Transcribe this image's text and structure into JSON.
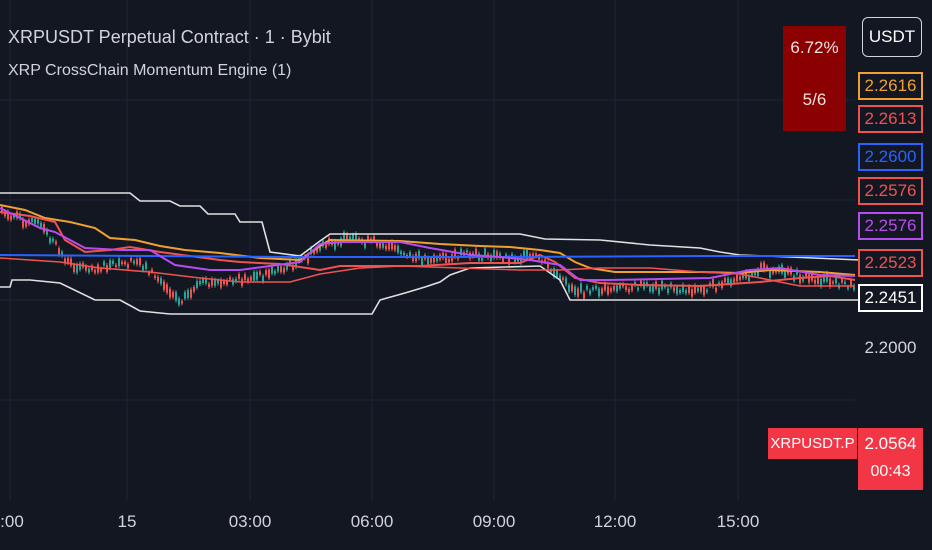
{
  "header": {
    "title": "XRPUSDT Perpetual Contract · 1 · Bybit",
    "indicator": "XRP CrossChain Momentum Engine (1)"
  },
  "info_panel": {
    "percent": "6.72%",
    "ratio": "5/6",
    "color": "#8b0000"
  },
  "currency_button": "USDT",
  "price_axis": {
    "tags": [
      {
        "value": "2.2616",
        "color": "#f0a030"
      },
      {
        "value": "2.2613",
        "color": "#ef5350"
      },
      {
        "value": "2.2600",
        "color": "#2962ff"
      },
      {
        "value": "2.2576",
        "color": "#ef5350"
      },
      {
        "value": "2.2576",
        "color": "#b74cf0"
      },
      {
        "value": "2.2523",
        "color": "#ef5350"
      },
      {
        "value": "2.2451",
        "color": "#ffffff"
      }
    ],
    "level_label": "2.2000",
    "symbol": "XRPUSDT.P",
    "last_price": "2.0564",
    "countdown": "00:43"
  },
  "time_axis": {
    "labels": [
      ":00",
      "15",
      "03:00",
      "06:00",
      "09:00",
      "12:00",
      "15:00"
    ]
  },
  "colors": {
    "background": "#131722",
    "grid": "#1f2433",
    "up_candle": "#26a69a",
    "down_candle": "#ef5350",
    "bull": "#f23645"
  },
  "chart_data": {
    "type": "line",
    "series": [
      {
        "color": "#ffffff",
        "role": "upper-band"
      },
      {
        "color": "#ffffff",
        "role": "lower-band"
      },
      {
        "color": "#f0a030"
      },
      {
        "color": "#ef5350"
      },
      {
        "color": "#2962ff"
      },
      {
        "color": "#b74cf0"
      },
      {
        "color": "#ef5350"
      }
    ],
    "candles": "price action"
  }
}
